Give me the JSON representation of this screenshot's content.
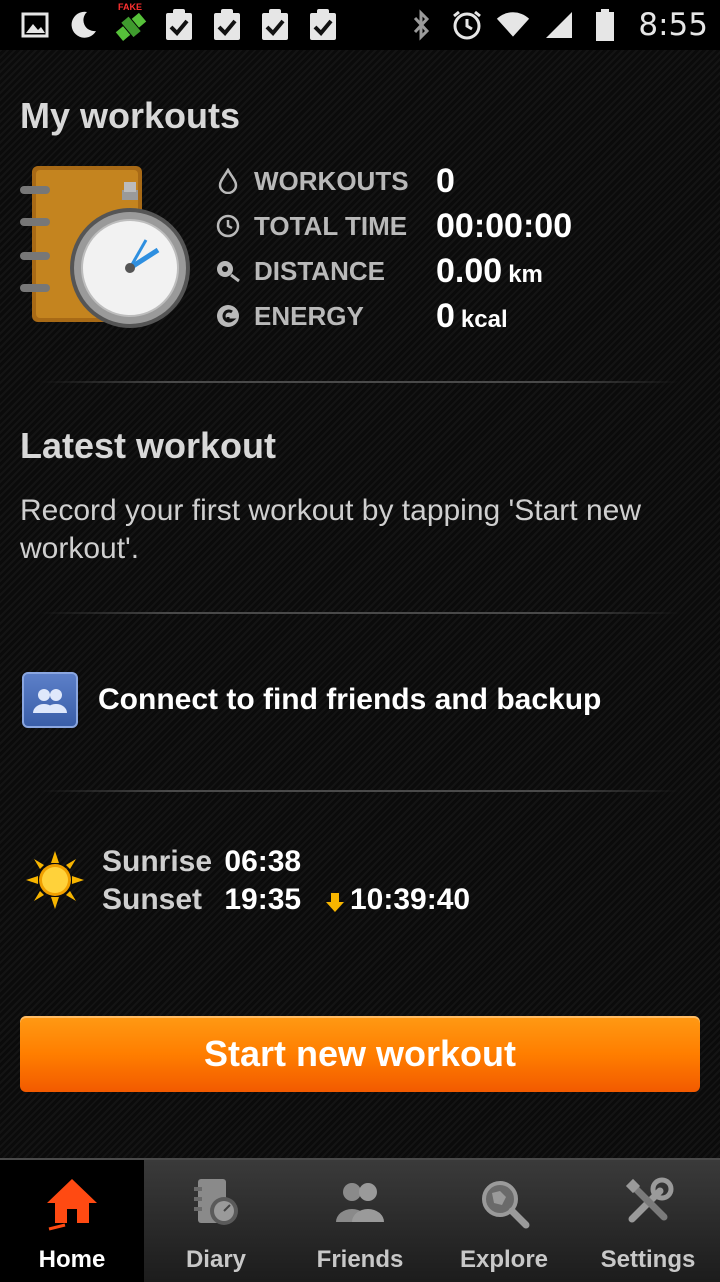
{
  "status_bar": {
    "time": "8:55",
    "left_icons": [
      "image-icon",
      "moon-icon",
      "fake-gps-satellite-icon",
      "clipboard-check-icon",
      "clipboard-check-icon",
      "clipboard-check-icon",
      "clipboard-check-icon"
    ],
    "right_icons": [
      "bluetooth-icon",
      "alarm-icon",
      "wifi-icon",
      "signal-icon",
      "battery-icon"
    ],
    "fake_badge": "FAKE"
  },
  "my_workouts": {
    "title": "My workouts",
    "stats": [
      {
        "label": "WORKOUTS",
        "value": "0",
        "unit": ""
      },
      {
        "label": "TOTAL TIME",
        "value": "00:00:00",
        "unit": ""
      },
      {
        "label": "DISTANCE",
        "value": "0.00",
        "unit": "km"
      },
      {
        "label": "ENERGY",
        "value": "0",
        "unit": "kcal"
      }
    ]
  },
  "latest_workout": {
    "title": "Latest workout",
    "message": "Record your first workout by tapping 'Start new workout'."
  },
  "connect": {
    "label": "Connect to find friends and backup"
  },
  "sun": {
    "sunrise_label": "Sunrise",
    "sunrise_time": "06:38",
    "sunset_label": "Sunset",
    "sunset_time": "19:35",
    "remaining": "10:39:40"
  },
  "start_button": {
    "label": "Start new workout"
  },
  "tabs": [
    {
      "label": "Home",
      "icon": "home-icon",
      "active": true
    },
    {
      "label": "Diary",
      "icon": "diary-icon",
      "active": false
    },
    {
      "label": "Friends",
      "icon": "friends-icon",
      "active": false
    },
    {
      "label": "Explore",
      "icon": "explore-icon",
      "active": false
    },
    {
      "label": "Settings",
      "icon": "settings-icon",
      "active": false
    }
  ],
  "colors": {
    "accent_orange": "#ff7e00",
    "active_home_icon": "#ff4a12",
    "connect_blue": "#4a6fc0",
    "sun_yellow": "#f7b500"
  }
}
